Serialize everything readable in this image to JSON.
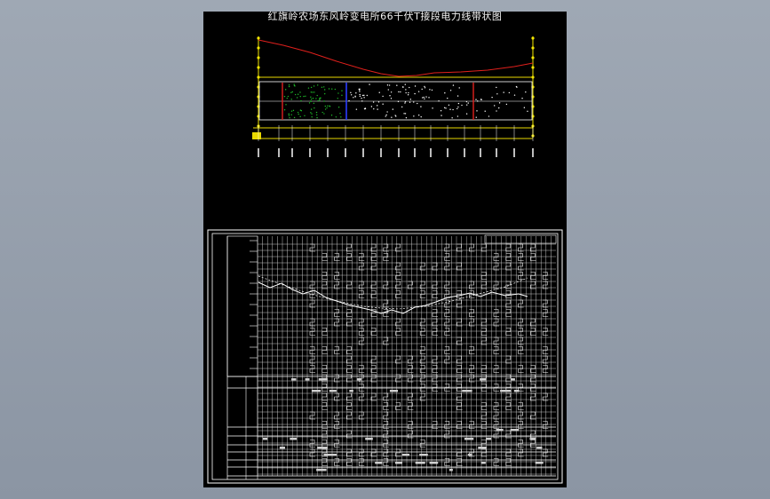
{
  "drawing": {
    "title": "红旗岭农场东风岭变电所66千伏T接段电力线带状图",
    "colors": {
      "background": "#000000",
      "line": "#ffffff",
      "profile": "#e0201c",
      "baseline": "#e8d800",
      "pole": "#f2e600",
      "vegetation": "#1fbf2a",
      "boundary_blue": "#2a3cff",
      "boundary_red": "#e0201c"
    }
  }
}
